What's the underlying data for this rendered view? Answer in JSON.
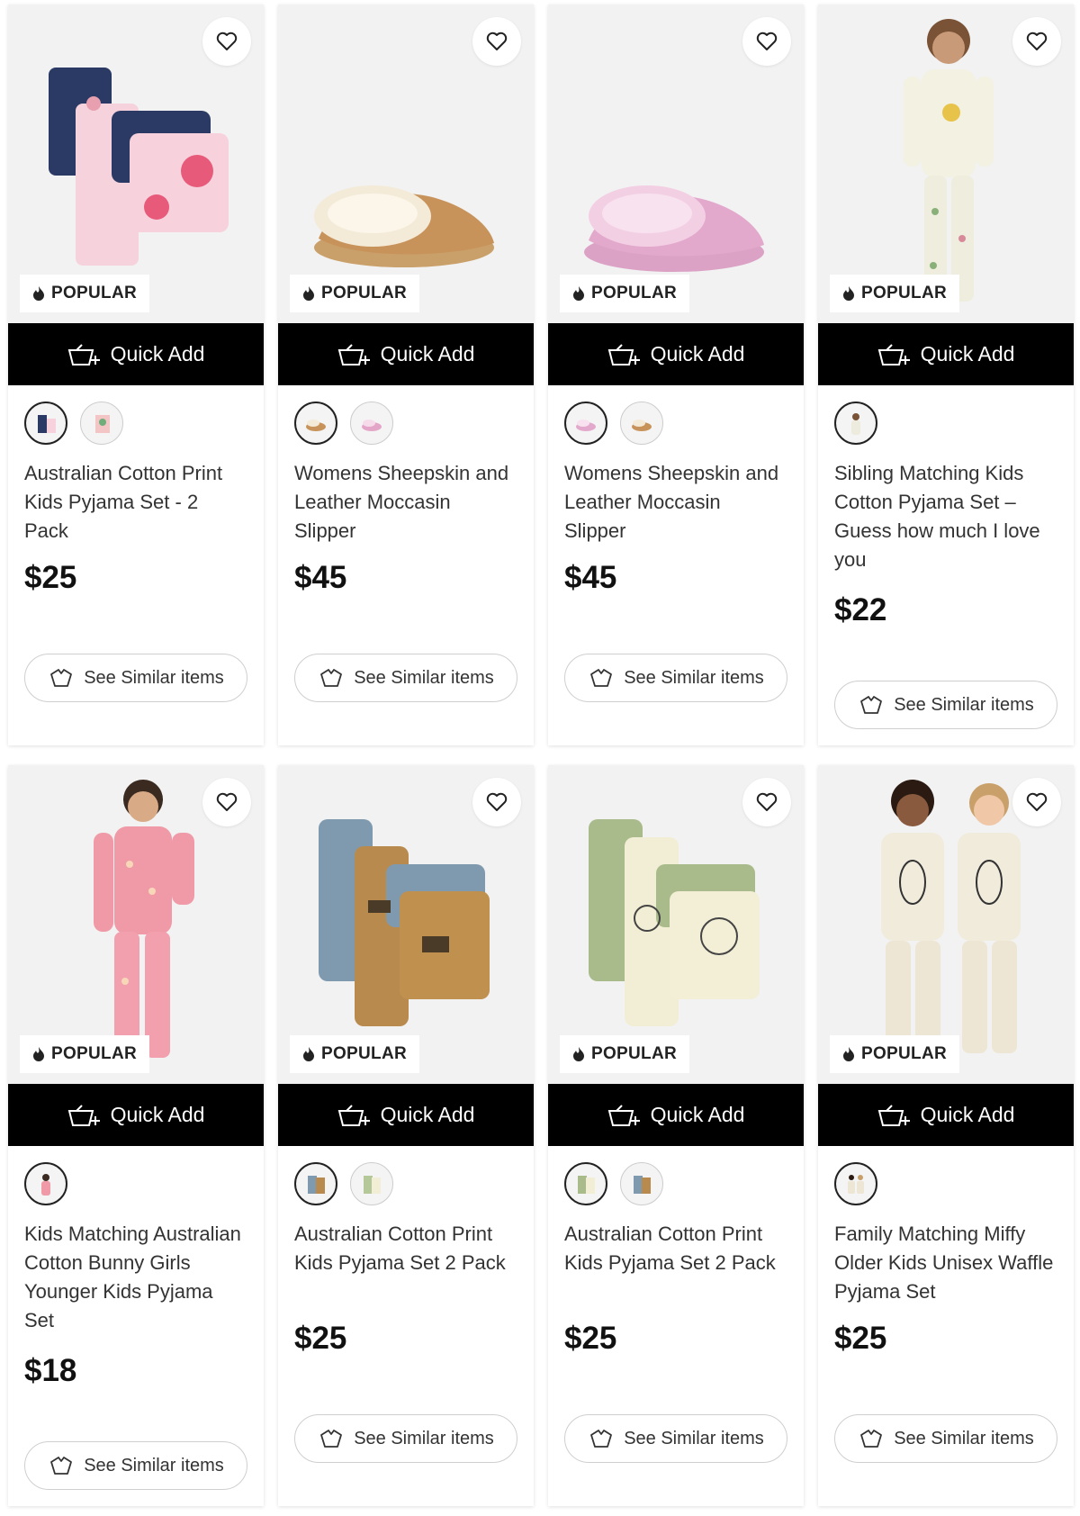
{
  "popular_label": "POPULAR",
  "quick_add_label": "Quick Add",
  "similar_label": "See Similar items",
  "products": [
    {
      "title": "Australian Cotton Print Kids Pyjama Set - 2 Pack",
      "price": "$25",
      "swatch_count": 2
    },
    {
      "title": "Womens Sheepskin and Leather Moccasin Slipper",
      "price": "$45",
      "swatch_count": 2
    },
    {
      "title": "Womens Sheepskin and Leather Moccasin Slipper",
      "price": "$45",
      "swatch_count": 2
    },
    {
      "title": "Sibling Matching Kids Cotton Pyjama Set – Guess how much I love you",
      "price": "$22",
      "swatch_count": 1
    },
    {
      "title": "Kids Matching Australian Cotton Bunny Girls Younger Kids Pyjama Set",
      "price": "$18",
      "swatch_count": 1
    },
    {
      "title": "Australian Cotton Print Kids Pyjama Set 2 Pack",
      "price": "$25",
      "swatch_count": 2
    },
    {
      "title": "Australian Cotton Print Kids Pyjama Set 2 Pack",
      "price": "$25",
      "swatch_count": 2
    },
    {
      "title": "Family Matching Miffy Older Kids Unisex Waffle Pyjama Set",
      "price": "$25",
      "swatch_count": 1
    }
  ]
}
